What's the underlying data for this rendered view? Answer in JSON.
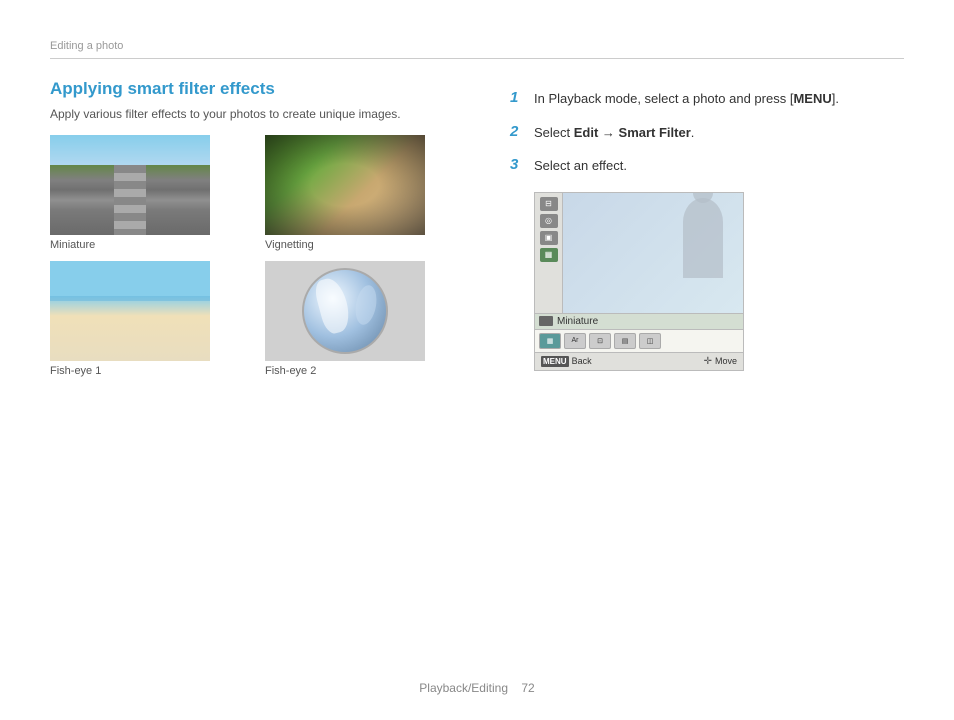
{
  "breadcrumb": "Editing a photo",
  "section": {
    "title": "Applying smart filter effects",
    "subtitle": "Apply various filter effects to your photos to create unique images."
  },
  "images": [
    {
      "id": "miniature",
      "label": "Miniature",
      "type": "miniature"
    },
    {
      "id": "vignetting",
      "label": "Vignetting",
      "type": "vignette"
    },
    {
      "id": "fisheye1",
      "label": "Fish-eye 1",
      "type": "fisheye1"
    },
    {
      "id": "fisheye2",
      "label": "Fish-eye 2",
      "type": "fisheye2"
    }
  ],
  "steps": [
    {
      "number": "1",
      "text_plain": "In Playback mode, select a photo and press [",
      "text_bold": "MENU",
      "text_end": "]."
    },
    {
      "number": "2",
      "text_plain": "Select ",
      "text_bold": "Edit → Smart Filter",
      "text_end": "."
    },
    {
      "number": "3",
      "text_plain": "Select an effect.",
      "text_bold": "",
      "text_end": ""
    }
  ],
  "camera_ui": {
    "selected_effect": "Miniature",
    "back_label": "Back",
    "move_label": "Move",
    "menu_label": "MENU"
  },
  "footer": {
    "text": "Playback/Editing",
    "page": "72"
  }
}
